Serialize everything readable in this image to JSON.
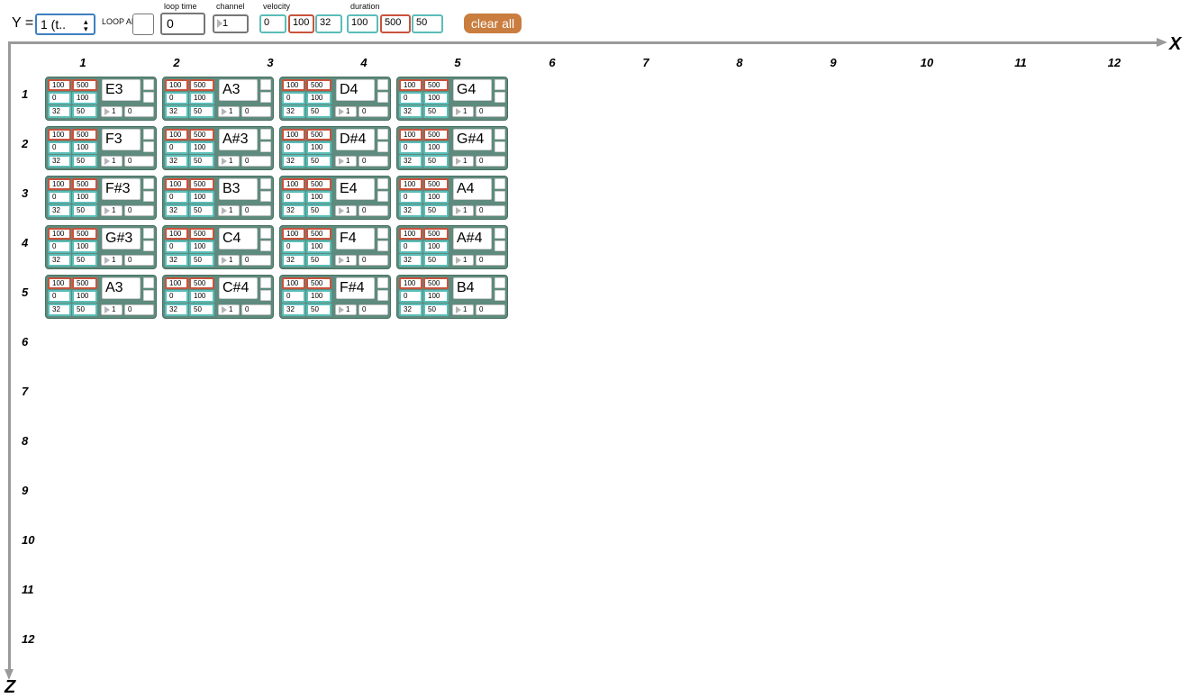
{
  "toolbar": {
    "y_label": "Y =",
    "y_value": "1 (t..",
    "spinner": "▴▾",
    "loop_all_label": "LOOP ALL",
    "loop_time_label": "loop time",
    "loop_time_value": "0",
    "channel_label": "channel",
    "channel_value": "1",
    "velocity_label": "velocity",
    "velocity_values": [
      "0",
      "100",
      "32"
    ],
    "duration_label": "duration",
    "duration_values": [
      "100",
      "500",
      "50"
    ],
    "clear_all_label": "clear all"
  },
  "axes": {
    "x_name": "X",
    "z_name": "Z",
    "columns": [
      "1",
      "2",
      "3",
      "4",
      "5",
      "6",
      "7",
      "8",
      "9",
      "10",
      "11",
      "12"
    ],
    "rows": [
      "1",
      "2",
      "3",
      "4",
      "5",
      "6",
      "7",
      "8",
      "9",
      "10",
      "11",
      "12"
    ]
  },
  "cell_defaults": {
    "dur_min": "100",
    "dur_max": "500",
    "vel_min": "0",
    "vel_max": "100",
    "vel_val": "32",
    "dur_val": "50",
    "channel": "1",
    "extra": "0"
  },
  "grid": {
    "notes": [
      [
        "E3",
        "A3",
        "D4",
        "G4"
      ],
      [
        "F3",
        "A#3",
        "D#4",
        "G#4"
      ],
      [
        "F#3",
        "B3",
        "E4",
        "A4"
      ],
      [
        "G#3",
        "C4",
        "F4",
        "A#4"
      ],
      [
        "A3",
        "C#4",
        "F#4",
        "B4"
      ]
    ]
  },
  "colors": {
    "cell_bg": "#5e8b7e",
    "accent_red": "#c9533c",
    "accent_teal": "#5bbdb8",
    "button": "#c97d3f",
    "axis": "#9a9a9a"
  }
}
